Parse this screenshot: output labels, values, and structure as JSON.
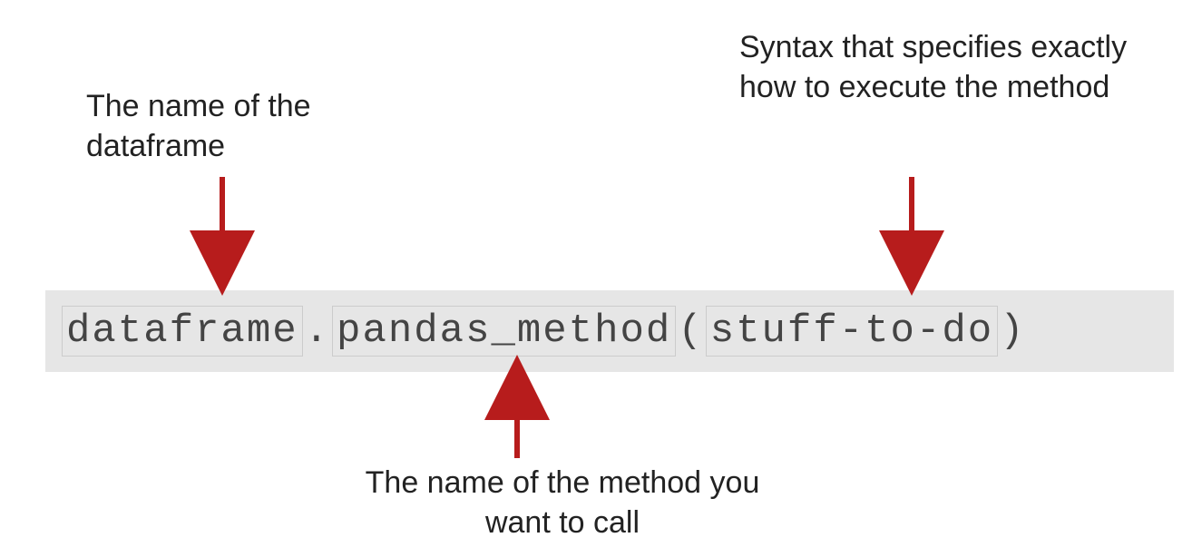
{
  "labels": {
    "dataframe_name": "The name of the dataframe",
    "syntax_spec": "Syntax that specifies exactly how to execute the method",
    "method_name": "The name of the method you want to call"
  },
  "code": {
    "part1": "dataframe",
    "dot": ".",
    "part2": "pandas_method",
    "open": "(",
    "part3": "stuff-to-do",
    "close": ")"
  },
  "colors": {
    "arrow": "#b71c1c"
  }
}
